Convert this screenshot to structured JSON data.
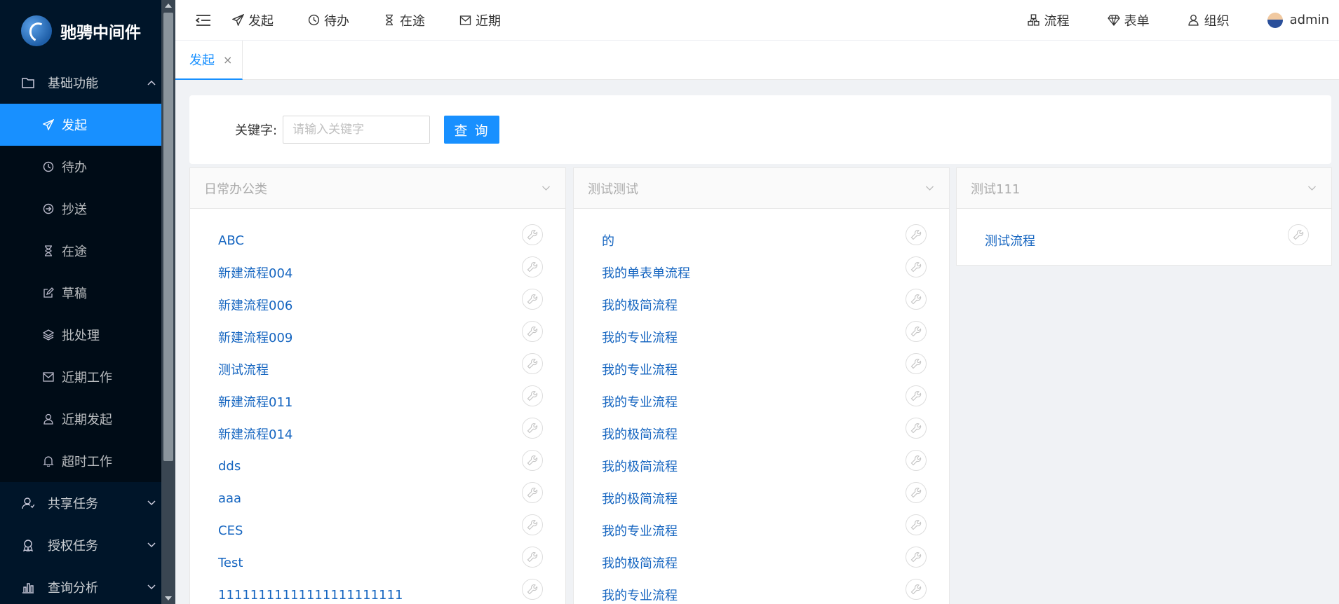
{
  "app": {
    "logo_text": "驰骋中间件"
  },
  "sidebar": {
    "group_basic": "基础功能",
    "items": [
      {
        "label": "发起",
        "icon": "send-icon",
        "active": true
      },
      {
        "label": "待办",
        "icon": "clock-icon"
      },
      {
        "label": "抄送",
        "icon": "arrow-right-circle-icon"
      },
      {
        "label": "在途",
        "icon": "hourglass-icon"
      },
      {
        "label": "草稿",
        "icon": "edit-icon"
      },
      {
        "label": "批处理",
        "icon": "layers-icon"
      },
      {
        "label": "近期工作",
        "icon": "mail-icon"
      },
      {
        "label": "近期发起",
        "icon": "user-icon"
      },
      {
        "label": "超时工作",
        "icon": "bell-icon"
      }
    ],
    "group_shared": "共享任务",
    "group_auth": "授权任务",
    "group_query": "查询分析"
  },
  "header": {
    "nav": [
      {
        "label": "发起",
        "icon": "send-icon"
      },
      {
        "label": "待办",
        "icon": "clock-icon"
      },
      {
        "label": "在途",
        "icon": "hourglass-icon"
      },
      {
        "label": "近期",
        "icon": "mail-icon"
      }
    ],
    "right": [
      {
        "label": "流程",
        "icon": "flow-icon"
      },
      {
        "label": "表单",
        "icon": "diamond-icon"
      },
      {
        "label": "组织",
        "icon": "org-icon"
      }
    ],
    "user": "admin"
  },
  "tabs": [
    {
      "label": "发起",
      "close": "×"
    }
  ],
  "search": {
    "label": "关键字:",
    "placeholder": "请输入关键字",
    "button": "查 询"
  },
  "categories": [
    {
      "title": "日常办公类",
      "flows": [
        "ABC",
        "新建流程004",
        "新建流程006",
        "新建流程009",
        "测试流程",
        "新建流程011",
        "新建流程014",
        "dds",
        "aaa",
        "CES",
        "Test",
        "11111111111111111111111"
      ]
    },
    {
      "title": "测试测试",
      "flows": [
        "的",
        "我的单表单流程",
        "我的极简流程",
        "我的专业流程",
        "我的专业流程",
        "我的专业流程",
        "我的极简流程",
        "我的极简流程",
        "我的极简流程",
        "我的专业流程",
        "我的极简流程",
        "我的专业流程"
      ]
    },
    {
      "title": "测试111",
      "flows": [
        "测试流程"
      ]
    }
  ],
  "colors": {
    "sidebar_bg": "#001529",
    "accent": "#1890ff",
    "link": "#1565c0"
  }
}
